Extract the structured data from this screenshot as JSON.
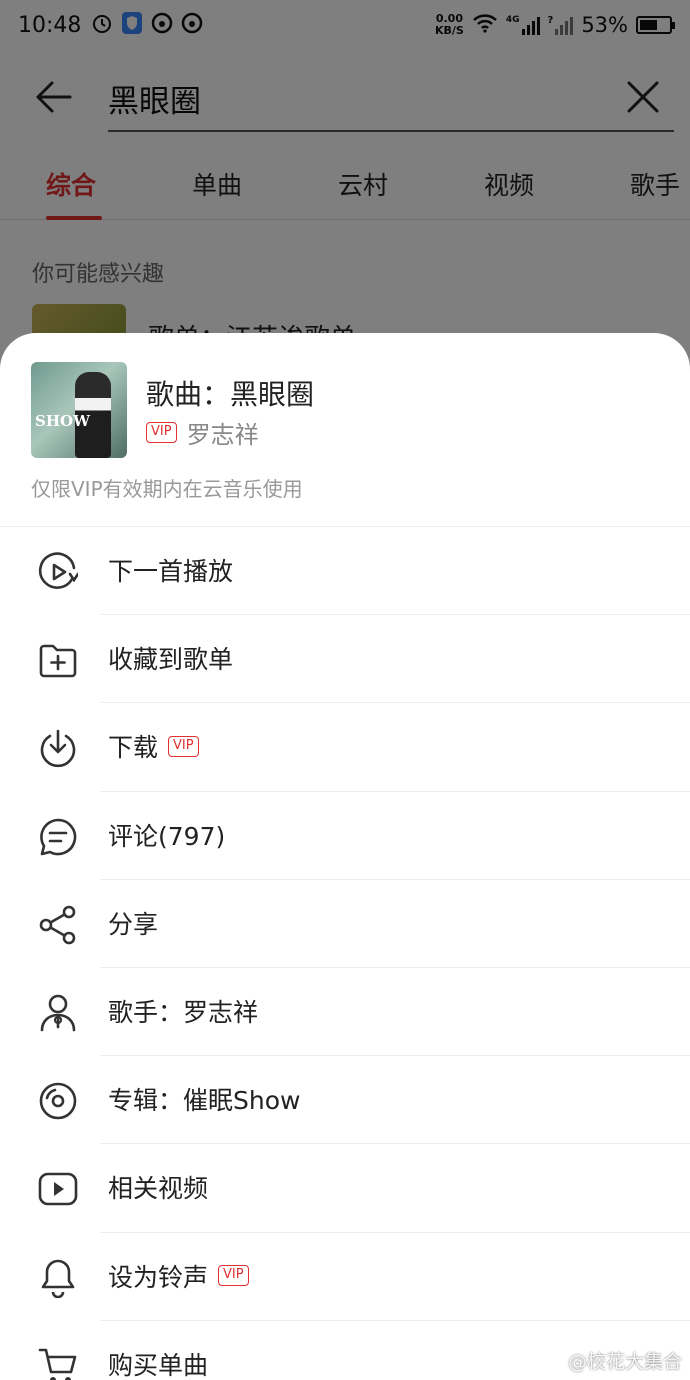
{
  "status_bar": {
    "time": "10:48",
    "net_speed_top": "0.00",
    "net_speed_unit": "KB/S",
    "network": "4G",
    "battery": "53%"
  },
  "search": {
    "query": "黑眼圈"
  },
  "tabs": [
    {
      "label": "综合",
      "active": true
    },
    {
      "label": "单曲",
      "active": false
    },
    {
      "label": "云村",
      "active": false
    },
    {
      "label": "视频",
      "active": false
    },
    {
      "label": "歌手",
      "active": false
    }
  ],
  "suggest": {
    "title": "你可能感兴趣",
    "item_text": "歌单：江苏诶歌单"
  },
  "sheet": {
    "song_title": "歌曲：黑眼圈",
    "vip_badge": "VIP",
    "artist": "罗志祥",
    "cover_text": "SHOW",
    "note": "仅限VIP有效期内在云音乐使用",
    "menu": [
      {
        "label": "下一首播放",
        "icon": "play-next-icon",
        "vip": false
      },
      {
        "label": "收藏到歌单",
        "icon": "add-folder-icon",
        "vip": false
      },
      {
        "label": "下载",
        "icon": "download-icon",
        "vip": true
      },
      {
        "label": "评论(797)",
        "icon": "comment-icon",
        "vip": false
      },
      {
        "label": "分享",
        "icon": "share-icon",
        "vip": false
      },
      {
        "label": "歌手：罗志祥",
        "icon": "artist-icon",
        "vip": false
      },
      {
        "label": "专辑：催眠Show",
        "icon": "album-icon",
        "vip": false
      },
      {
        "label": "相关视频",
        "icon": "video-icon",
        "vip": false
      },
      {
        "label": "设为铃声",
        "icon": "bell-icon",
        "vip": true
      },
      {
        "label": "购买单曲",
        "icon": "cart-icon",
        "vip": false
      }
    ]
  },
  "watermark": "@校花大集合",
  "colors": {
    "accent": "#e03030",
    "overlay": "rgba(0,0,0,0.5)"
  }
}
